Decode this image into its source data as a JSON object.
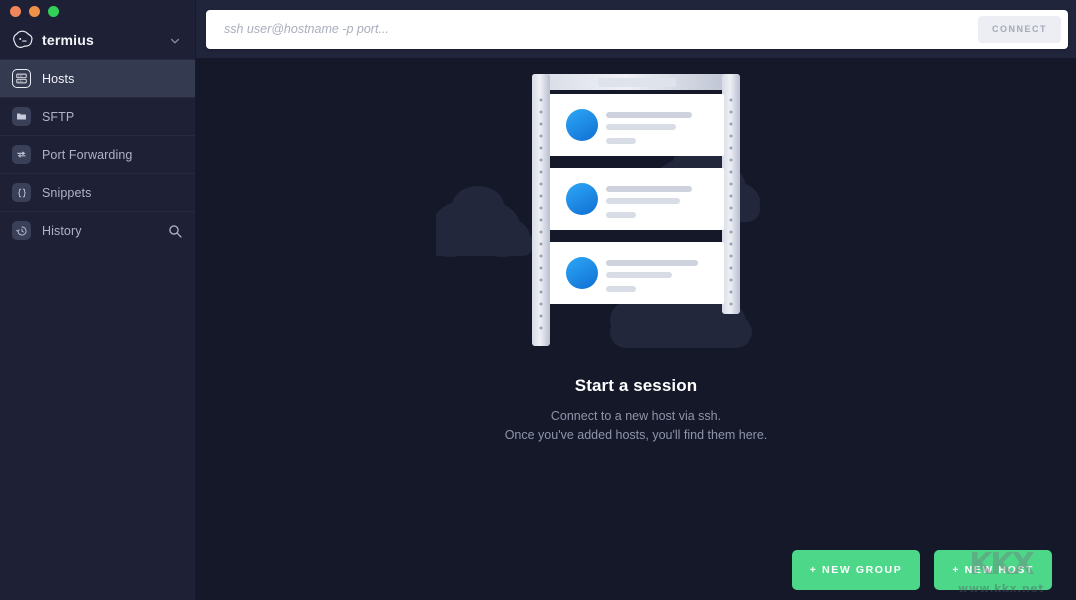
{
  "window": {
    "traffic_lights": [
      {
        "name": "close",
        "color": "#f0875a"
      },
      {
        "name": "minimize",
        "color": "#f0914a"
      },
      {
        "name": "maximize",
        "color": "#31d158"
      }
    ]
  },
  "sidebar": {
    "brand": {
      "name": "termius",
      "logo_icon": "termius-cloud-logo-icon",
      "chevron_icon": "chevron-down-icon"
    },
    "items": [
      {
        "label": "Hosts",
        "icon": "server-rack-icon",
        "active": true,
        "action_icon": null
      },
      {
        "label": "SFTP",
        "icon": "folder-icon",
        "active": false,
        "action_icon": null
      },
      {
        "label": "Port Forwarding",
        "icon": "arrows-transfer-icon",
        "active": false,
        "action_icon": null
      },
      {
        "label": "Snippets",
        "icon": "curly-braces-icon",
        "active": false,
        "action_icon": null
      },
      {
        "label": "History",
        "icon": "clock-history-icon",
        "active": false,
        "action_icon": "search-icon"
      }
    ]
  },
  "topbar": {
    "input_placeholder": "ssh user@hostname -p port...",
    "input_value": "",
    "connect_label": "CONNECT"
  },
  "empty_state": {
    "illustration_icon": "server-rack-clouds-illustration",
    "title": "Start a session",
    "line1": "Connect to a new host via ssh.",
    "line2": "Once you've added hosts, you'll find them here."
  },
  "actions": {
    "new_group_label": "+ NEW GROUP",
    "new_host_label": "+ NEW HOST"
  },
  "watermark": {
    "glyphs": "KKX",
    "url": "www.kkx.net"
  },
  "colors": {
    "sidebar_bg": "#1e2135",
    "main_bg": "#141829",
    "topbar_bg": "#21253b",
    "accent_green": "#4dd889",
    "active_row": "#343a50",
    "avatar_blue": "#2196f3",
    "text_primary": "#ffffff",
    "text_muted": "#8f95aa"
  }
}
